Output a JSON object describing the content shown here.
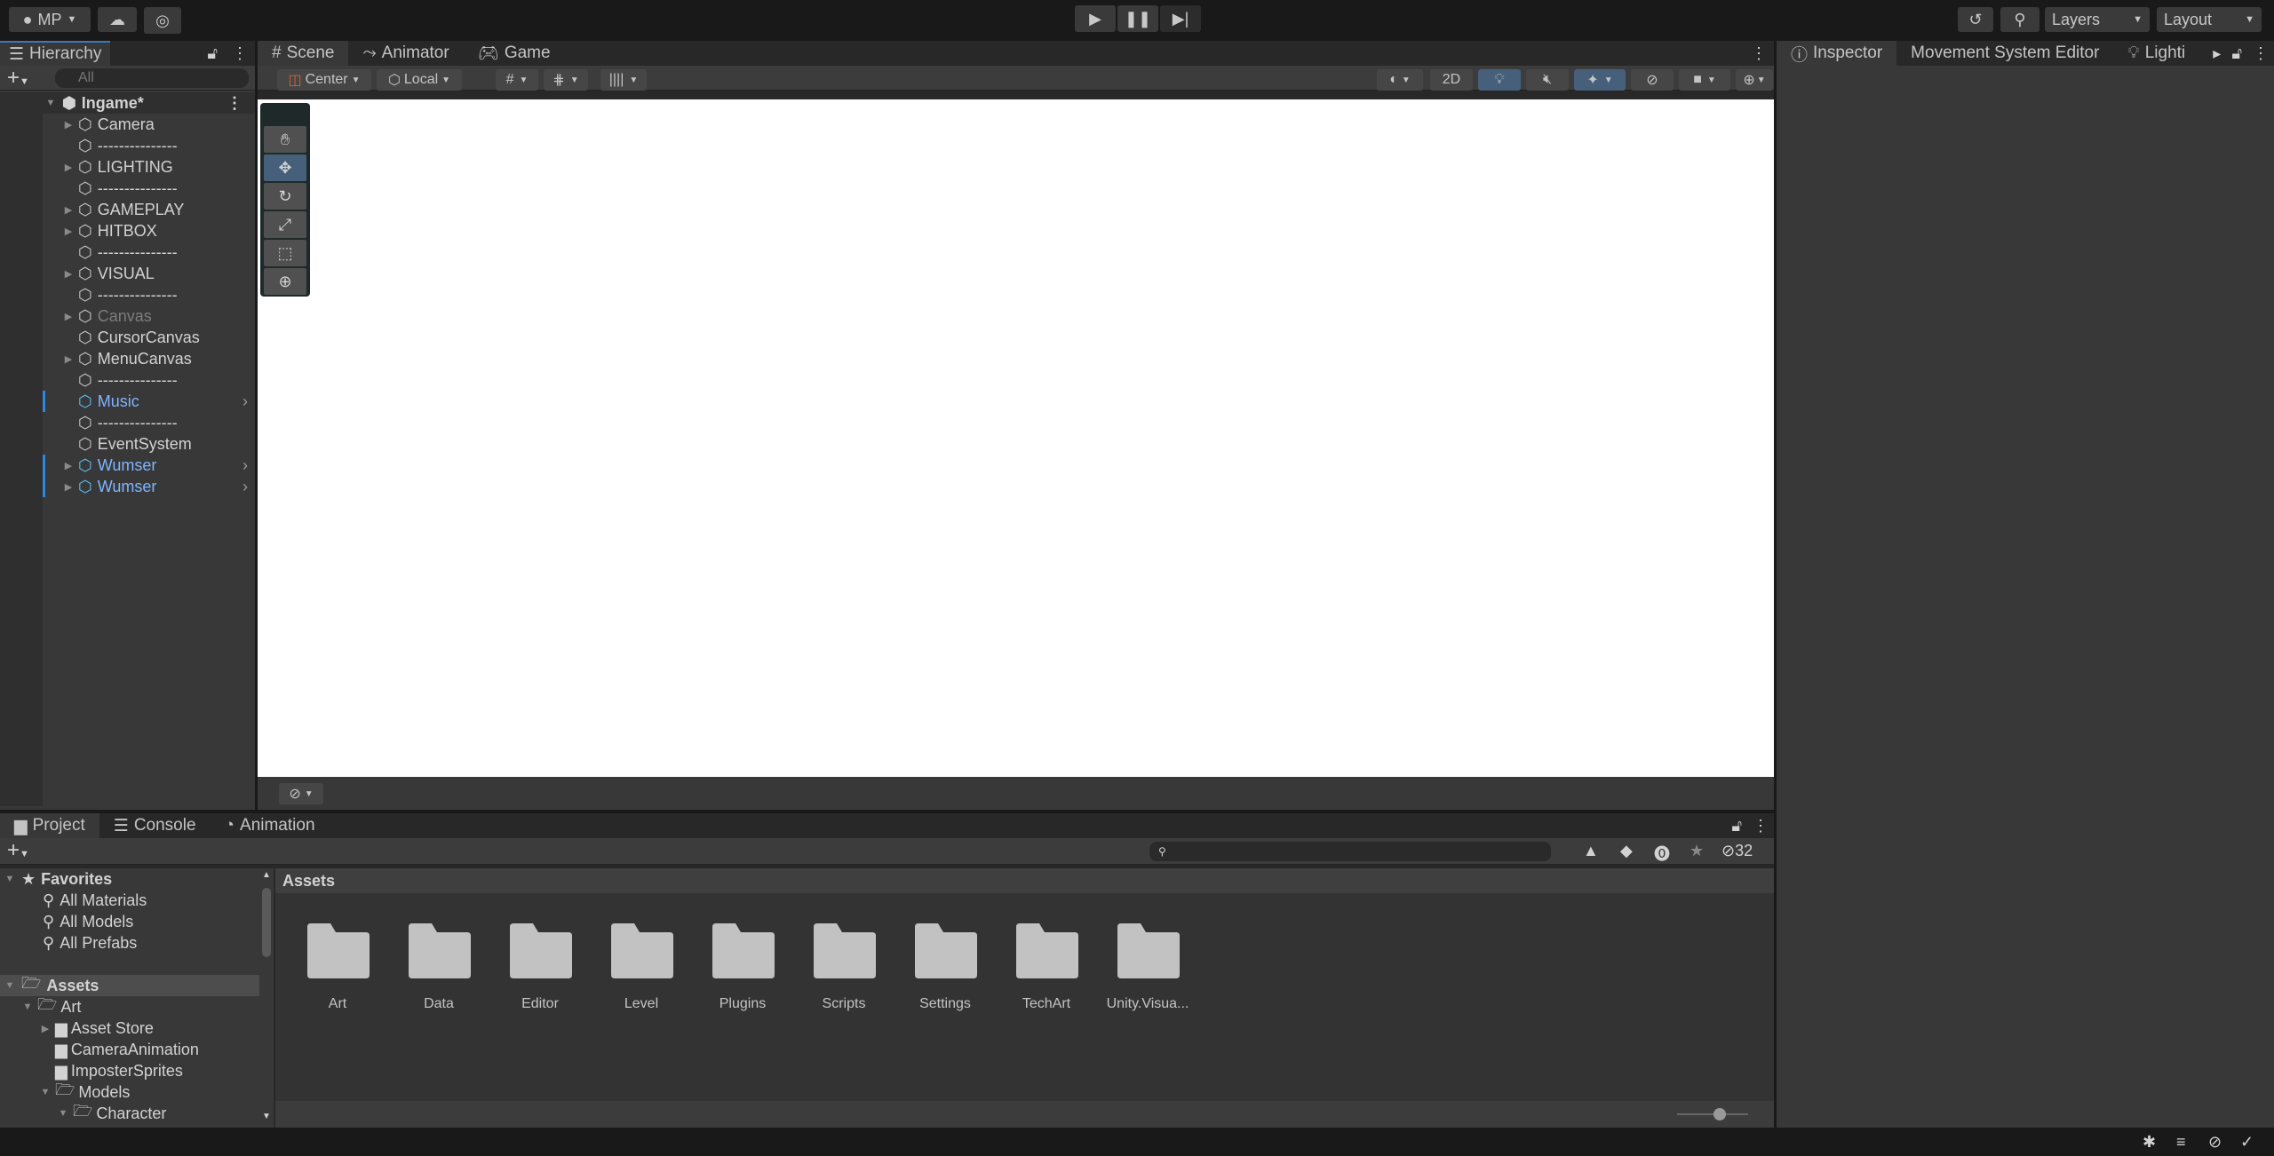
{
  "topbar": {
    "account": "MP",
    "layers": "Layers",
    "layout": "Layout",
    "icons": [
      "account-icon",
      "cloud-icon",
      "collab-icon",
      "play-icon",
      "pause-icon",
      "step-icon",
      "history-icon",
      "search-icon"
    ]
  },
  "hierarchy": {
    "tab": "Hierarchy",
    "search_placeholder": "All",
    "scene": "Ingame*",
    "items": [
      {
        "label": "Camera",
        "expand": true,
        "type": "normal"
      },
      {
        "label": "---------------",
        "expand": false,
        "type": "normal"
      },
      {
        "label": "LIGHTING",
        "expand": true,
        "type": "normal"
      },
      {
        "label": "---------------",
        "expand": false,
        "type": "normal"
      },
      {
        "label": "GAMEPLAY",
        "expand": true,
        "type": "normal"
      },
      {
        "label": "HITBOX",
        "expand": true,
        "type": "normal"
      },
      {
        "label": "---------------",
        "expand": false,
        "type": "normal"
      },
      {
        "label": "VISUAL",
        "expand": true,
        "type": "normal"
      },
      {
        "label": "---------------",
        "expand": false,
        "type": "normal"
      },
      {
        "label": "Canvas",
        "expand": true,
        "type": "disabled"
      },
      {
        "label": "CursorCanvas",
        "expand": false,
        "type": "normal"
      },
      {
        "label": "MenuCanvas",
        "expand": true,
        "type": "normal"
      },
      {
        "label": "---------------",
        "expand": false,
        "type": "normal"
      },
      {
        "label": "Music",
        "expand": false,
        "type": "prefab"
      },
      {
        "label": "---------------",
        "expand": false,
        "type": "normal"
      },
      {
        "label": "EventSystem",
        "expand": false,
        "type": "normal"
      },
      {
        "label": "Wumser",
        "expand": true,
        "type": "prefab"
      },
      {
        "label": "Wumser",
        "expand": true,
        "type": "prefab"
      }
    ]
  },
  "scene": {
    "tabs": [
      "Scene",
      "Animator",
      "Game"
    ],
    "pivot": "Center",
    "space": "Local",
    "mode_2d": "2D",
    "tools": [
      "hand-tool",
      "move-tool",
      "rotate-tool",
      "scale-tool",
      "rect-tool",
      "transform-tool"
    ],
    "active_tool": "move-tool"
  },
  "inspector": {
    "tabs": [
      "Inspector",
      "Movement System Editor",
      "Lighti"
    ]
  },
  "project": {
    "tabs": [
      "Project",
      "Console",
      "Animation"
    ],
    "hidden_count": "32",
    "favorites_label": "Favorites",
    "favorites": [
      "All Materials",
      "All Models",
      "All Prefabs"
    ],
    "assets_label": "Assets",
    "tree": [
      {
        "label": "Art",
        "depth": 1,
        "open": true,
        "arrow": "down"
      },
      {
        "label": "Asset Store",
        "depth": 2,
        "open": false,
        "arrow": "right"
      },
      {
        "label": "CameraAnimation",
        "depth": 2,
        "open": false,
        "arrow": ""
      },
      {
        "label": "ImposterSprites",
        "depth": 2,
        "open": false,
        "arrow": ""
      },
      {
        "label": "Models",
        "depth": 2,
        "open": true,
        "arrow": "down"
      },
      {
        "label": "Character",
        "depth": 3,
        "open": true,
        "arrow": "down"
      }
    ],
    "breadcrumb": "Assets",
    "folders": [
      "Art",
      "Data",
      "Editor",
      "Level",
      "Plugins",
      "Scripts",
      "Settings",
      "TechArt",
      "Unity.Visua..."
    ],
    "zoom_slider": 0.6
  }
}
